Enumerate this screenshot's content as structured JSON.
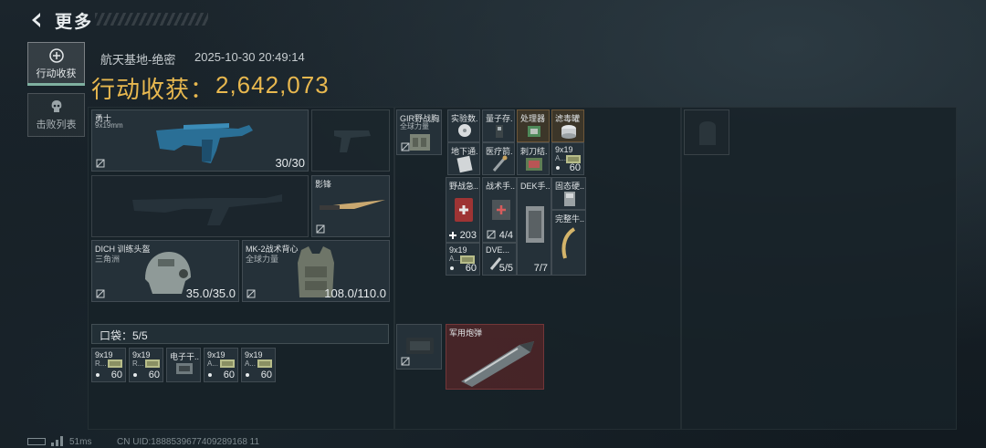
{
  "header": {
    "title": "更多"
  },
  "nav": {
    "items": [
      {
        "label": "行动收获"
      },
      {
        "label": "击败列表"
      }
    ]
  },
  "info": {
    "map": "航天基地-绝密",
    "datetime": "2025-10-30 20:49:14",
    "loot_label": "行动收获：",
    "loot_value": "2,642,073"
  },
  "equipment": {
    "primary": {
      "name": "勇士",
      "caliber": "9x19mm",
      "ammo": "30/30"
    },
    "melee": {
      "name": "影锋"
    },
    "helmet": {
      "name": "DICH 训练头盔",
      "faction": "三角洲",
      "durability": "35.0/35.0"
    },
    "armor": {
      "name": "MK-2战术背心",
      "faction": "全球力量",
      "durability": "108.0/110.0"
    },
    "pocket": {
      "label": "口袋：5/5"
    },
    "pocket_items": [
      {
        "name": "9x19",
        "sub": "R...",
        "count": "60"
      },
      {
        "name": "9x19",
        "sub": "R...",
        "count": "60"
      },
      {
        "name": "电子干..."
      },
      {
        "name": "9x19",
        "sub": "A...",
        "count": "60"
      },
      {
        "name": "9x19",
        "sub": "A...",
        "count": "60"
      }
    ]
  },
  "chest_rig": {
    "name": "GIR野战胸...",
    "faction": "全球力量",
    "items": [
      {
        "name": "实验数..."
      },
      {
        "name": "量子存..."
      },
      {
        "name": "处理器"
      },
      {
        "name": "滤毒罐"
      },
      {
        "name": "地下通..."
      },
      {
        "name": "医疗箭..."
      },
      {
        "name": "刺刀结..."
      },
      {
        "name": "9x19",
        "sub": "A...",
        "count": "60"
      }
    ]
  },
  "backpack_items": [
    {
      "name": "野战急...",
      "count": "203"
    },
    {
      "name": "战术手...",
      "count": "4/4"
    },
    {
      "name": "DEK手..."
    },
    {
      "name": "固态硬..."
    },
    {
      "name": "完整牛..."
    },
    {
      "name": "9x19",
      "sub": "A...",
      "count": "60"
    },
    {
      "name": "DVE...",
      "count": "5/5"
    },
    {
      "name": "",
      "count": "7/7"
    }
  ],
  "extra": {
    "shell": {
      "name": "军用炮弹"
    }
  },
  "footer": {
    "ping": "51ms",
    "uid": "CN UID:1888539677409289168 11"
  }
}
